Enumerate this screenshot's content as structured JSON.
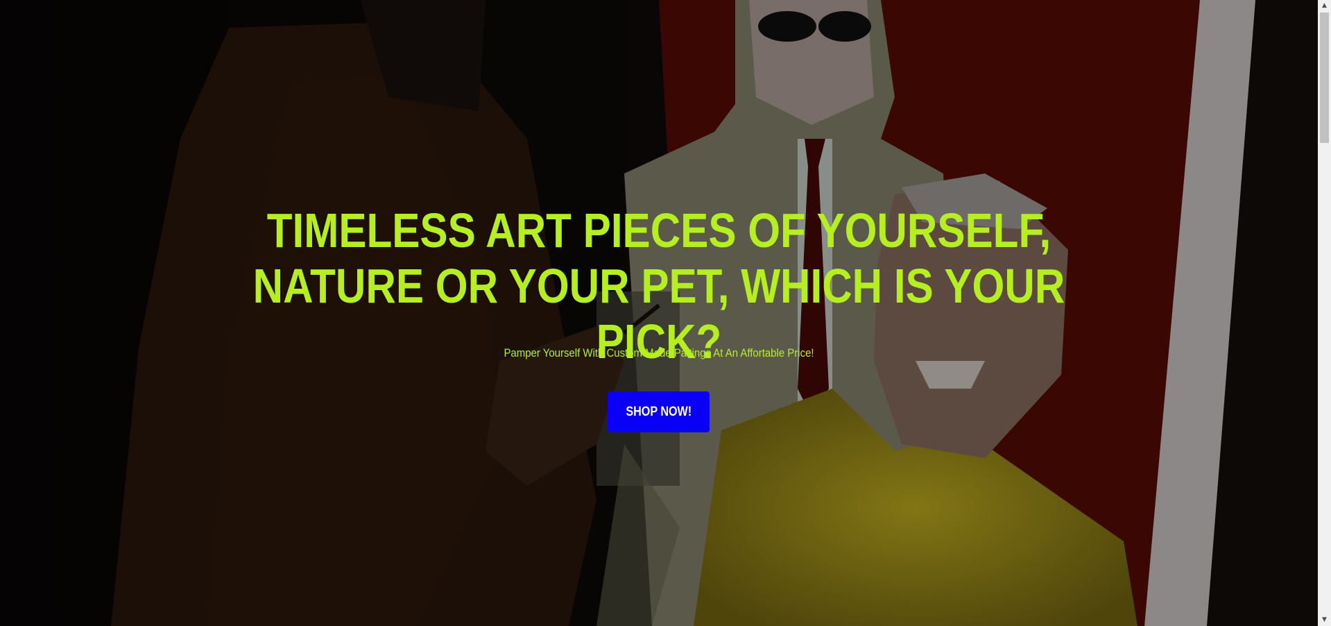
{
  "hero": {
    "headline": "TIMELESS ART PIECES OF YOURSELF, NATURE OR YOUR PET, WHICH IS YOUR PICK?",
    "subheadline": "Pamper Yourself With Custom Made Paitings At An Affortable Price!",
    "cta_label": "SHOP NOW!"
  },
  "scrollbar": {
    "up_icon": "triangle-up-icon",
    "down_icon": "triangle-down-icon"
  },
  "colors": {
    "accent": "#b5ef1f",
    "button": "#0a00f5",
    "button_text": "#ffffff"
  }
}
